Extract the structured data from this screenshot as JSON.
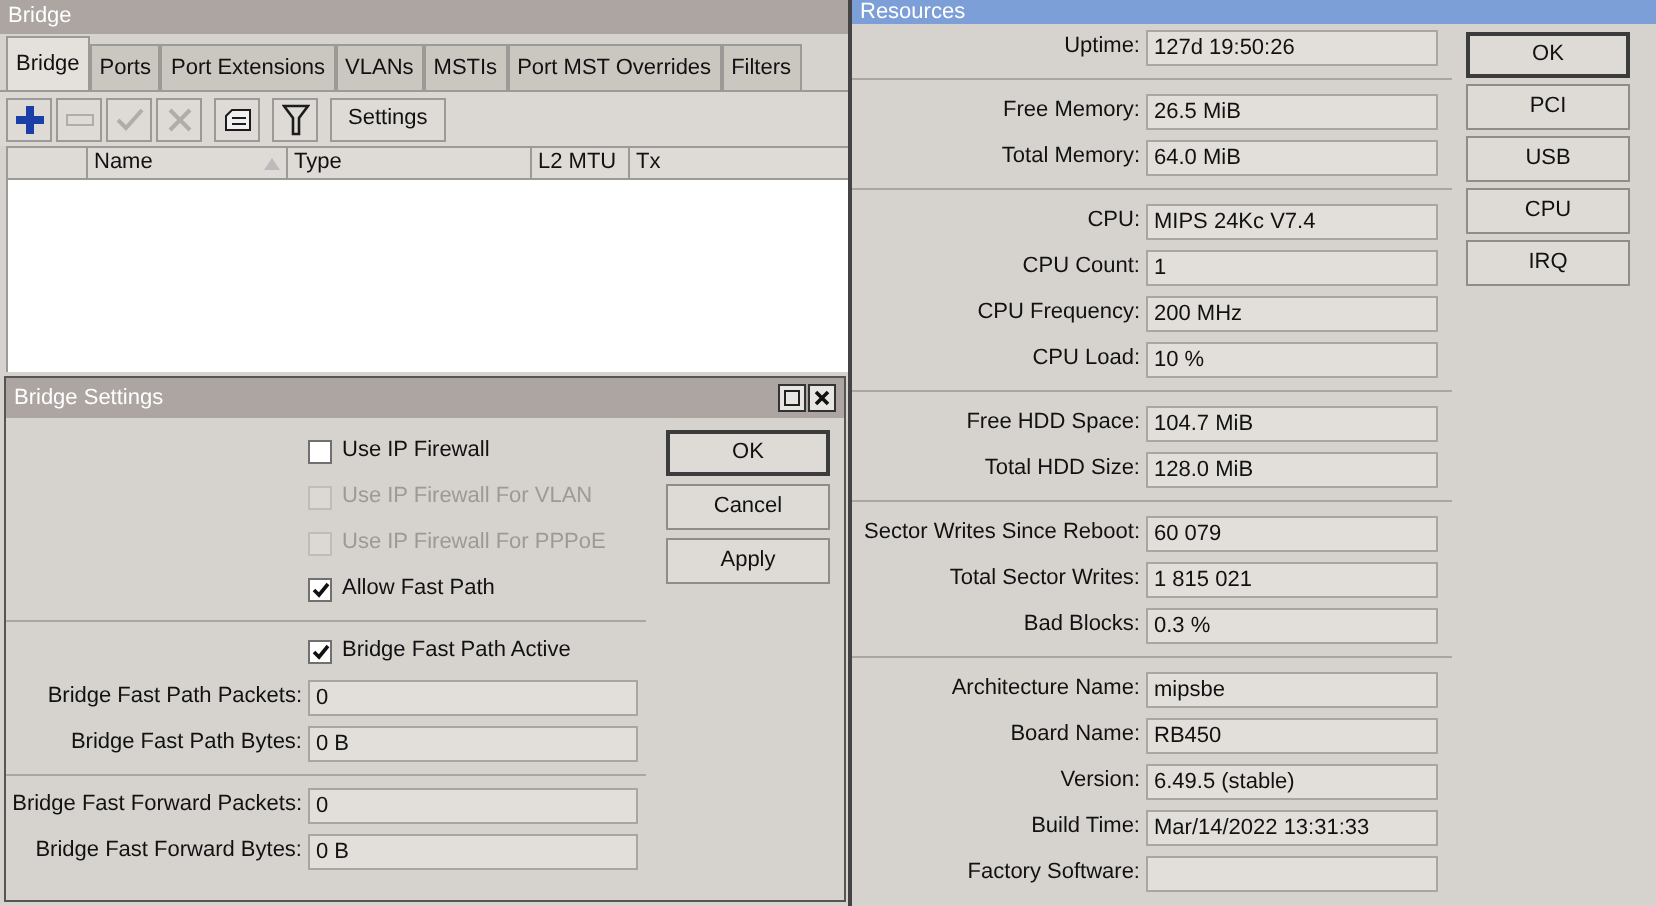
{
  "bridge_window": {
    "title": "Bridge",
    "tabs": [
      {
        "label": "Bridge",
        "selected": true
      },
      {
        "label": "Ports",
        "selected": false
      },
      {
        "label": "Port Extensions",
        "selected": false
      },
      {
        "label": "VLANs",
        "selected": false
      },
      {
        "label": "MSTIs",
        "selected": false
      },
      {
        "label": "Port MST Overrides",
        "selected": false
      },
      {
        "label": "Filters",
        "selected": false
      }
    ],
    "toolbar": [
      {
        "kind": "add",
        "disabled": false
      },
      {
        "kind": "remove",
        "disabled": true
      },
      {
        "kind": "enable",
        "disabled": true
      },
      {
        "kind": "disable",
        "disabled": true
      },
      {
        "kind": "comment",
        "disabled": false
      },
      {
        "kind": "filter",
        "disabled": false
      },
      {
        "kind": "text",
        "label": "Settings",
        "disabled": false
      }
    ],
    "table": {
      "columns": [
        {},
        {
          "label": "Name",
          "sorted": true
        },
        {
          "label": "Type"
        },
        {
          "label": "L2 MTU"
        },
        {
          "label": "Tx"
        }
      ]
    }
  },
  "bridge_settings": {
    "title": "Bridge Settings",
    "sections": [
      [
        {
          "kind": "checkbox",
          "label": "Use IP Firewall",
          "checked": false,
          "disabled": false
        },
        {
          "kind": "checkbox",
          "label": "Use IP Firewall For VLAN",
          "checked": false,
          "disabled": true
        },
        {
          "kind": "checkbox",
          "label": "Use IP Firewall For PPPoE",
          "checked": false,
          "disabled": true
        },
        {
          "kind": "checkbox",
          "label": "Allow Fast Path",
          "checked": true,
          "disabled": false
        }
      ],
      [
        {
          "kind": "checkbox",
          "label": "Bridge Fast Path Active",
          "checked": true,
          "disabled": false
        },
        {
          "kind": "field",
          "label": "Bridge Fast Path Packets:",
          "value": "0"
        },
        {
          "kind": "field",
          "label": "Bridge Fast Path Bytes:",
          "value": "0 B"
        }
      ],
      [
        {
          "kind": "field",
          "label": "Bridge Fast Forward Packets:",
          "value": "0"
        },
        {
          "kind": "field",
          "label": "Bridge Fast Forward Bytes:",
          "value": "0 B"
        }
      ]
    ],
    "buttons": [
      {
        "label": "OK",
        "default": true
      },
      {
        "label": "Cancel",
        "default": false
      },
      {
        "label": "Apply",
        "default": false
      }
    ]
  },
  "resources": {
    "title": "Resources",
    "groups": [
      [
        {
          "label": "Uptime:",
          "value": "127d 19:50:26"
        }
      ],
      [
        {
          "label": "Free Memory:",
          "value": "26.5 MiB"
        },
        {
          "label": "Total Memory:",
          "value": "64.0 MiB"
        }
      ],
      [
        {
          "label": "CPU:",
          "value": "MIPS 24Kc V7.4"
        },
        {
          "label": "CPU Count:",
          "value": "1"
        },
        {
          "label": "CPU Frequency:",
          "value": "200 MHz"
        },
        {
          "label": "CPU Load:",
          "value": "10 %"
        }
      ],
      [
        {
          "label": "Free HDD Space:",
          "value": "104.7 MiB"
        },
        {
          "label": "Total HDD Size:",
          "value": "128.0 MiB"
        }
      ],
      [
        {
          "label": "Sector Writes Since Reboot:",
          "value": "60 079"
        },
        {
          "label": "Total Sector Writes:",
          "value": "1 815 021"
        },
        {
          "label": "Bad Blocks:",
          "value": "0.3 %"
        }
      ],
      [
        {
          "label": "Architecture Name:",
          "value": "mipsbe"
        },
        {
          "label": "Board Name:",
          "value": "RB450"
        },
        {
          "label": "Version:",
          "value": "6.49.5 (stable)"
        },
        {
          "label": "Build Time:",
          "value": "Mar/14/2022 13:31:33"
        },
        {
          "label": "Factory Software:"
        }
      ]
    ],
    "buttons": [
      {
        "label": "OK",
        "default": true
      },
      {
        "label": "PCI",
        "default": false
      },
      {
        "label": "USB",
        "default": false
      },
      {
        "label": "CPU",
        "default": false
      },
      {
        "label": "IRQ",
        "default": false
      }
    ]
  }
}
